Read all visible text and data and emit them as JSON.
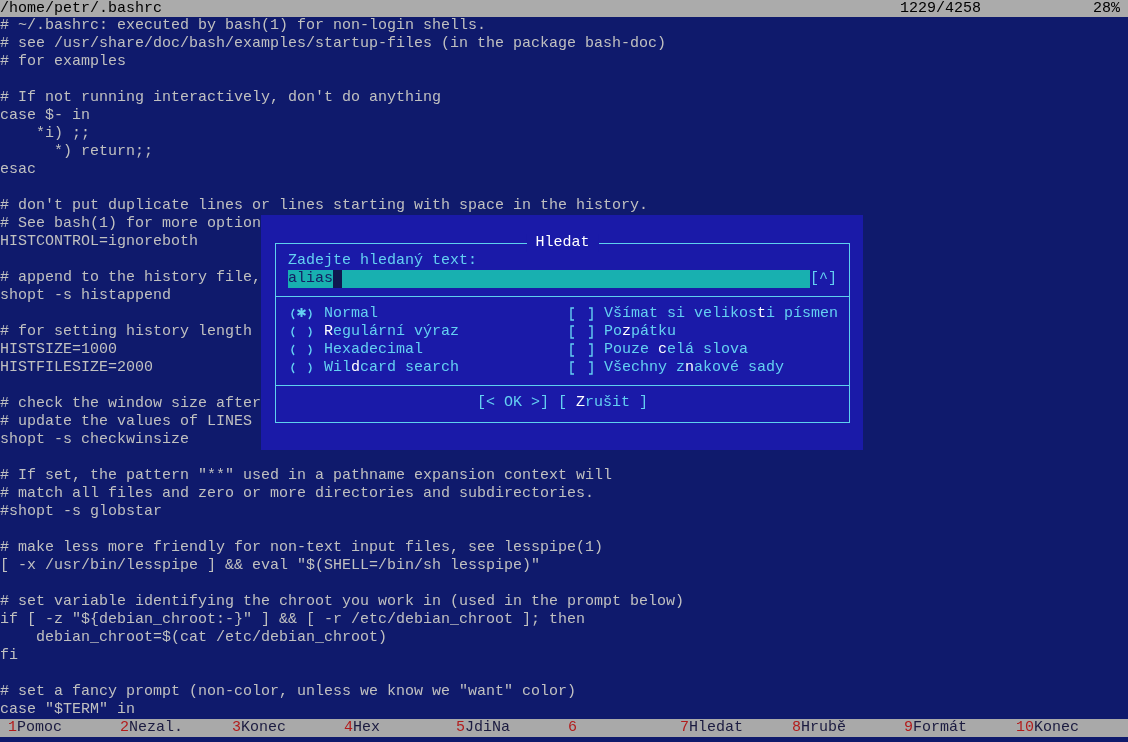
{
  "title_bar": {
    "path": "/home/petr/.bashrc",
    "position": "1229/4258",
    "percent": "28%"
  },
  "lines": [
    {
      "kind": "text",
      "text": "# ~/.bashrc: executed by bash(1) for non-login shells."
    },
    {
      "kind": "text",
      "text": "# see /usr/share/doc/bash/examples/startup-files (in the package bash-doc)"
    },
    {
      "kind": "text",
      "text": "# for examples"
    },
    {
      "kind": "blank"
    },
    {
      "kind": "text",
      "text": "# If not running interactively, don't do anything"
    },
    {
      "kind": "text",
      "text": "case $- in"
    },
    {
      "kind": "text",
      "text": "    *i) ;;"
    },
    {
      "kind": "text",
      "text": "      *) return;;"
    },
    {
      "kind": "text",
      "text": "esac"
    },
    {
      "kind": "blank"
    },
    {
      "kind": "text",
      "text": "# don't put duplicate lines or lines starting with space in the history."
    },
    {
      "kind": "text",
      "text": "# See bash(1) for more option"
    },
    {
      "kind": "text",
      "text": "HISTCONTROL=ignoreboth"
    },
    {
      "kind": "blank"
    },
    {
      "kind": "text",
      "text": "# append to the history file,"
    },
    {
      "kind": "text",
      "text": "shopt -s histappend"
    },
    {
      "kind": "blank"
    },
    {
      "kind": "text",
      "text": "# for setting history length"
    },
    {
      "kind": "text",
      "text": "HISTSIZE=1000"
    },
    {
      "kind": "text",
      "text": "HISTFILESIZE=2000"
    },
    {
      "kind": "blank"
    },
    {
      "kind": "text",
      "text": "# check the window size after"
    },
    {
      "kind": "text",
      "text": "# update the values of LINES"
    },
    {
      "kind": "text",
      "text": "shopt -s checkwinsize"
    },
    {
      "kind": "blank"
    },
    {
      "kind": "text",
      "text": "# If set, the pattern \"**\" used in a pathname expansion context will"
    },
    {
      "kind": "text",
      "text": "# match all files and zero or more directories and subdirectories."
    },
    {
      "kind": "text",
      "text": "#shopt -s globstar"
    },
    {
      "kind": "blank"
    },
    {
      "kind": "text",
      "text": "# make less more friendly for non-text input files, see lesspipe(1)"
    },
    {
      "kind": "text",
      "text": "[ -x /usr/bin/lesspipe ] && eval \"$(SHELL=/bin/sh lesspipe)\""
    },
    {
      "kind": "blank"
    },
    {
      "kind": "text",
      "text": "# set variable identifying the chroot you work in (used in the prompt below)"
    },
    {
      "kind": "text",
      "text": "if [ -z \"${debian_chroot:-}\" ] && [ -r /etc/debian_chroot ]; then"
    },
    {
      "kind": "text",
      "text": "    debian_chroot=$(cat /etc/debian_chroot)"
    },
    {
      "kind": "text",
      "text": "fi"
    },
    {
      "kind": "blank"
    },
    {
      "kind": "text",
      "text": "# set a fancy prompt (non-color, unless we know we \"want\" color)"
    },
    {
      "kind": "text",
      "text": "case \"$TERM\" in"
    }
  ],
  "dialog": {
    "title": "Hledat",
    "prompt": "Zadejte hledaný text:",
    "value": "alias",
    "history_button": "[^]",
    "radios": [
      {
        "label": "Normal",
        "selected": true
      },
      {
        "label": "**R**egulární výraz",
        "selected": false
      },
      {
        "label": "Hexadecimal",
        "selected": false
      },
      {
        "label": "Wil**d**card search",
        "selected": false
      }
    ],
    "checkboxes": [
      {
        "label": "Všímat si velikos**t**i písmen",
        "checked": false
      },
      {
        "label": "Po**z**pátku",
        "checked": false
      },
      {
        "label": "Pouze **c**elá slova",
        "checked": false
      },
      {
        "label": "Všechny z**n**akové sady",
        "checked": false
      }
    ],
    "buttons": [
      "[< OK >]",
      "[ **Z**rušit ]"
    ]
  },
  "function_keys": [
    {
      "number": "1",
      "label": "Pomoc"
    },
    {
      "number": "2",
      "label": "Nezal."
    },
    {
      "number": "3",
      "label": "Konec"
    },
    {
      "number": "4",
      "label": "Hex"
    },
    {
      "number": "5",
      "label": "JdiNa"
    },
    {
      "number": "6"
    },
    {
      "number": "7",
      "label": "Hledat"
    },
    {
      "number": "8",
      "label": "Hrubě"
    },
    {
      "number": "9",
      "label": "Formát"
    },
    {
      "number": "10",
      "label": "Konec"
    }
  ]
}
